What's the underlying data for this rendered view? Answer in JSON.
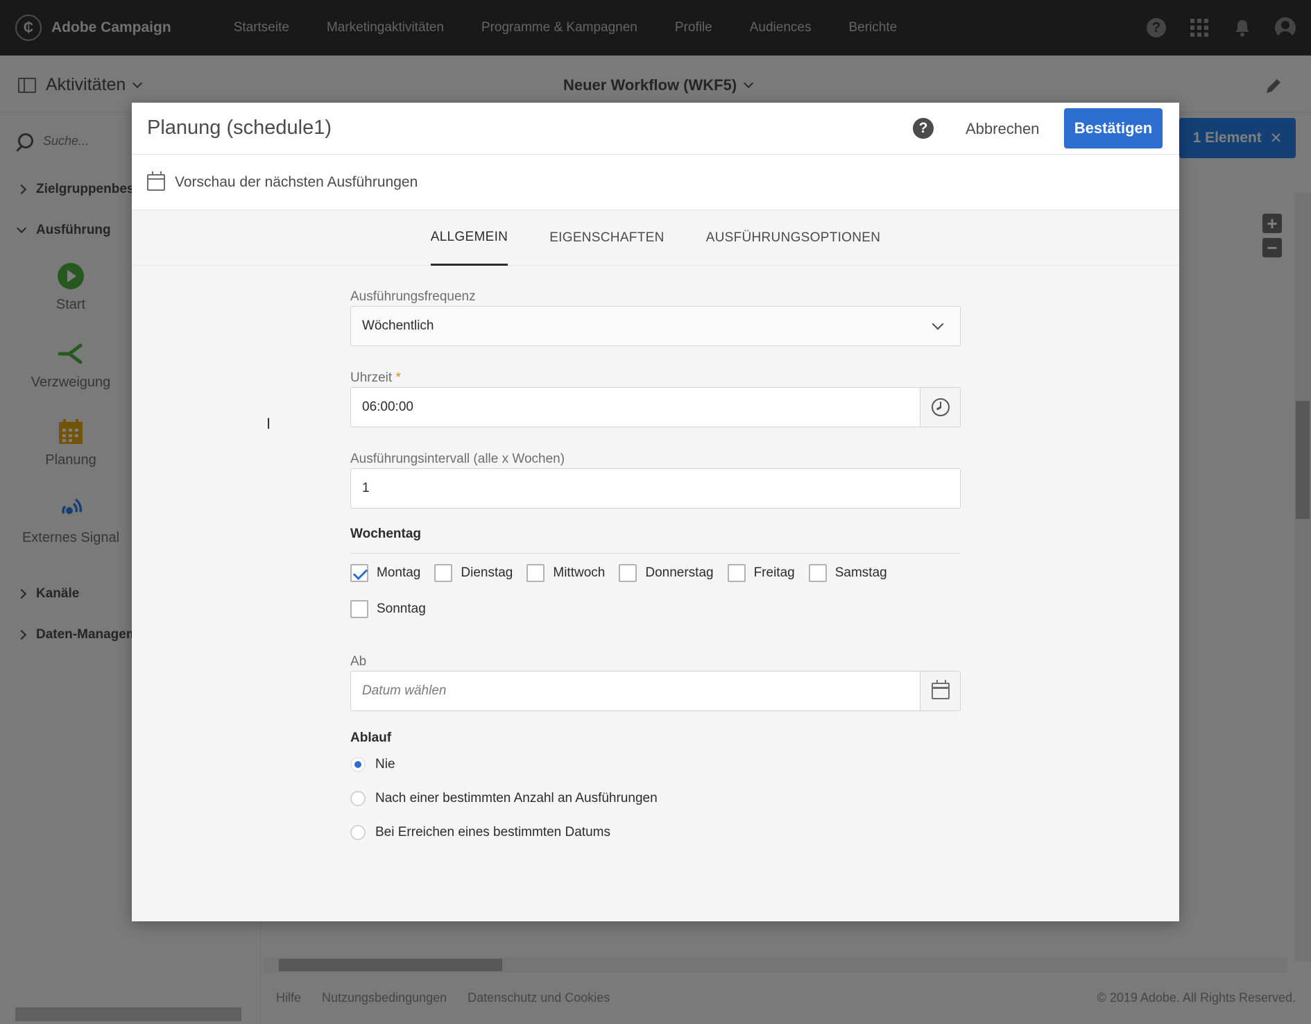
{
  "app": {
    "name": "Adobe Campaign"
  },
  "topnav": {
    "items": [
      "Startseite",
      "Marketingaktivitäten",
      "Programme & Kampagnen",
      "Profile",
      "Audiences",
      "Berichte"
    ],
    "help_glyph": "?"
  },
  "subheader": {
    "activities_label": "Aktivitäten",
    "workflow_title": "Neuer Workflow (WKF5)"
  },
  "leftpanel": {
    "search_placeholder": "Suche...",
    "categories": [
      {
        "label": "Zielgruppenbest",
        "expanded": false
      },
      {
        "label": "Ausführung",
        "expanded": true
      },
      {
        "label": "Kanäle",
        "expanded": false
      },
      {
        "label": "Daten-Managem",
        "expanded": false
      }
    ],
    "activities": [
      {
        "label": "Start",
        "icon": "start-play-icon",
        "color": "#4cb140"
      },
      {
        "label": "Verzweigung",
        "icon": "fork-icon",
        "color": "#4cb140"
      },
      {
        "label": "Planung",
        "icon": "calendar-icon",
        "color": "#e6a817"
      },
      {
        "label": "Externes Signal",
        "icon": "signal-icon",
        "color": "#2680eb"
      }
    ]
  },
  "canvas": {
    "selection_label": "1 Element",
    "close_glyph": "✕",
    "zoom_in": "+",
    "zoom_out": "−"
  },
  "footer": {
    "links": [
      "Hilfe",
      "Nutzungsbedingungen",
      "Datenschutz und Cookies"
    ],
    "copyright": "© 2019 Adobe. All Rights Reserved."
  },
  "dialog": {
    "title": "Planung (schedule1)",
    "help_glyph": "?",
    "cancel_label": "Abbrechen",
    "confirm_label": "Bestätigen",
    "preview_label": "Vorschau der nächsten Ausführungen",
    "tabs": [
      {
        "label": "ALLGEMEIN",
        "active": true
      },
      {
        "label": "EIGENSCHAFTEN",
        "active": false
      },
      {
        "label": "AUSFÜHRUNGSOPTIONEN",
        "active": false
      }
    ],
    "form": {
      "frequency_label": "Ausführungsfrequenz",
      "frequency_value": "Wöchentlich",
      "time_label": "Uhrzeit",
      "required_mark": "*",
      "time_value": "06:00:00",
      "interval_label": "Ausführungsintervall (alle x Wochen)",
      "interval_value": "1",
      "weekday_title": "Wochentag",
      "weekdays": [
        {
          "label": "Montag",
          "checked": true
        },
        {
          "label": "Dienstag",
          "checked": false
        },
        {
          "label": "Mittwoch",
          "checked": false
        },
        {
          "label": "Donnerstag",
          "checked": false
        },
        {
          "label": "Freitag",
          "checked": false
        },
        {
          "label": "Samstag",
          "checked": false
        },
        {
          "label": "Sonntag",
          "checked": false
        }
      ],
      "from_label": "Ab",
      "from_placeholder": "Datum wählen",
      "expiry_title": "Ablauf",
      "expiry_options": [
        {
          "label": "Nie",
          "selected": true
        },
        {
          "label": "Nach einer bestimmten Anzahl an Ausführungen",
          "selected": false
        },
        {
          "label": "Bei Erreichen eines bestimmten Datums",
          "selected": false
        }
      ]
    }
  },
  "colors": {
    "accent": "#2d6fd1",
    "topnav_bg": "#323232",
    "required": "#e68619"
  }
}
